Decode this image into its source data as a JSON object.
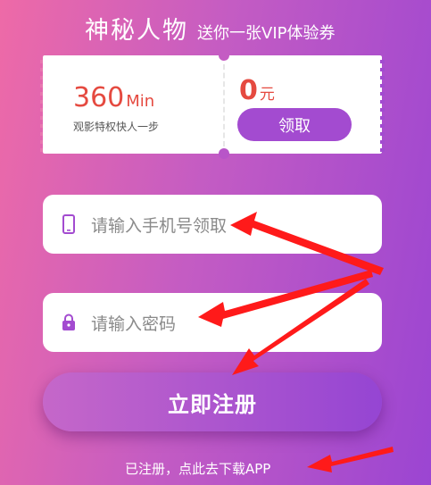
{
  "header": {
    "title": "神秘人物",
    "subtitle": "送你一张VIP体验券"
  },
  "ticket": {
    "amount": "360",
    "amount_unit": "Min",
    "description": "观影特权快人一步",
    "price": "0",
    "price_unit": "元",
    "claim_label": "领取"
  },
  "form": {
    "phone_placeholder": "请输入手机号领取",
    "password_placeholder": "请输入密码",
    "register_label": "立即注册",
    "download_link": "已注册，点此去下载APP"
  },
  "colors": {
    "accent_purple": "#a34bd0",
    "price_red": "#e54a40",
    "annotation_red": "#ff1a1a"
  },
  "icons": [
    "phone-icon",
    "lock-icon"
  ]
}
